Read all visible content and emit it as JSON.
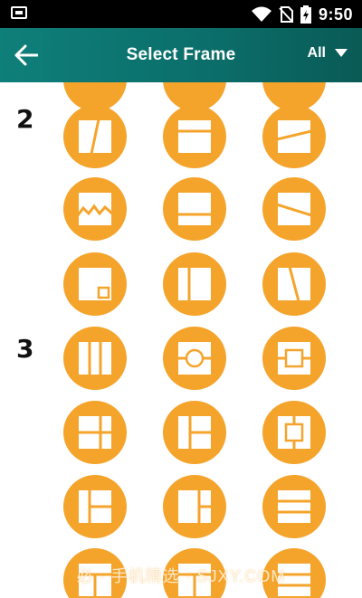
{
  "status_bar": {
    "time": "9:50"
  },
  "app_bar": {
    "title": "Select Frame",
    "filter_label": "All"
  },
  "groups": [
    {
      "label": "2"
    },
    {
      "label": "3"
    }
  ],
  "watermark": "必 · 手机精选 · SJXY.COM",
  "colors": {
    "accent": "#f5a42b",
    "appbar": "#0b6d69"
  }
}
